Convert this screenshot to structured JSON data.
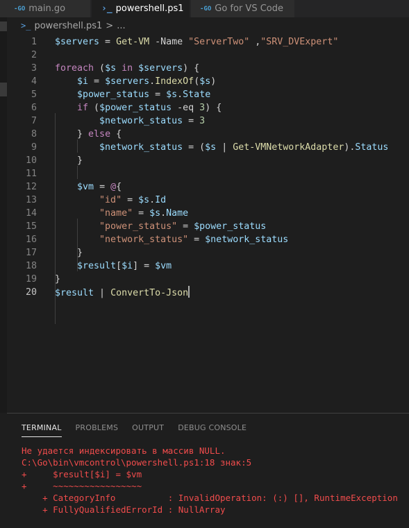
{
  "tabs": [
    {
      "label": "main.go",
      "icon": "go-file-icon",
      "active": false
    },
    {
      "label": "powershell.ps1",
      "icon": "powershell-file-icon",
      "active": true,
      "unsaved": true
    },
    {
      "label": "Go for VS Code",
      "icon": "go-extension-icon",
      "active": false
    }
  ],
  "icons": {
    "go": "-GO",
    "ps": ">_"
  },
  "breadcrumb": {
    "file": "powershell.ps1",
    "separator": ">",
    "rest": "..."
  },
  "editor": {
    "active_line": 20,
    "lines": [
      {
        "n": "1"
      },
      {
        "n": "2"
      },
      {
        "n": "3"
      },
      {
        "n": "4"
      },
      {
        "n": "5"
      },
      {
        "n": "6"
      },
      {
        "n": "7"
      },
      {
        "n": "8"
      },
      {
        "n": "9"
      },
      {
        "n": "10"
      },
      {
        "n": "11"
      },
      {
        "n": "12"
      },
      {
        "n": "13"
      },
      {
        "n": "14"
      },
      {
        "n": "15"
      },
      {
        "n": "16"
      },
      {
        "n": "17"
      },
      {
        "n": "18"
      },
      {
        "n": "19"
      },
      {
        "n": "20"
      }
    ],
    "code": [
      [
        [
          "v",
          "$servers"
        ],
        [
          "p",
          " = "
        ],
        [
          "f",
          "Get-VM"
        ],
        [
          "p",
          " -Name "
        ],
        [
          "s",
          "\"ServerTwo\""
        ],
        [
          "p",
          " ,"
        ],
        [
          "s",
          "\"SRV_DVExpert\""
        ]
      ],
      [],
      [
        [
          "k",
          "foreach"
        ],
        [
          "p",
          " ("
        ],
        [
          "v",
          "$s"
        ],
        [
          "k",
          " in "
        ],
        [
          "v",
          "$servers"
        ],
        [
          "p",
          ") {"
        ]
      ],
      [
        [
          "p",
          "    "
        ],
        [
          "v",
          "$i"
        ],
        [
          "p",
          " = "
        ],
        [
          "v",
          "$servers"
        ],
        [
          "p",
          "."
        ],
        [
          "f",
          "IndexOf"
        ],
        [
          "p",
          "("
        ],
        [
          "v",
          "$s"
        ],
        [
          "p",
          ")"
        ]
      ],
      [
        [
          "p",
          "    "
        ],
        [
          "v",
          "$power_status"
        ],
        [
          "p",
          " = "
        ],
        [
          "v",
          "$s"
        ],
        [
          "p",
          "."
        ],
        [
          "v",
          "State"
        ]
      ],
      [
        [
          "p",
          "    "
        ],
        [
          "k",
          "if"
        ],
        [
          "p",
          " ("
        ],
        [
          "v",
          "$power_status"
        ],
        [
          "p",
          " -eq "
        ],
        [
          "n",
          "3"
        ],
        [
          "p",
          ") {"
        ]
      ],
      [
        [
          "p",
          "        "
        ],
        [
          "v",
          "$network_status"
        ],
        [
          "p",
          " = "
        ],
        [
          "n",
          "3"
        ]
      ],
      [
        [
          "p",
          "    } "
        ],
        [
          "k",
          "else"
        ],
        [
          "p",
          " {"
        ]
      ],
      [
        [
          "p",
          "        "
        ],
        [
          "v",
          "$network_status"
        ],
        [
          "p",
          " = ("
        ],
        [
          "v",
          "$s"
        ],
        [
          "p",
          " | "
        ],
        [
          "f",
          "Get-VMNetworkAdapter"
        ],
        [
          "p",
          ")."
        ],
        [
          "v",
          "Status"
        ]
      ],
      [
        [
          "p",
          "    }"
        ]
      ],
      [],
      [
        [
          "p",
          "    "
        ],
        [
          "v",
          "$vm"
        ],
        [
          "p",
          " = "
        ],
        [
          "k",
          "@"
        ],
        [
          "p",
          "{"
        ]
      ],
      [
        [
          "p",
          "        "
        ],
        [
          "s",
          "\"id\""
        ],
        [
          "p",
          " = "
        ],
        [
          "v",
          "$s"
        ],
        [
          "p",
          "."
        ],
        [
          "v",
          "Id"
        ]
      ],
      [
        [
          "p",
          "        "
        ],
        [
          "s",
          "\"name\""
        ],
        [
          "p",
          " = "
        ],
        [
          "v",
          "$s"
        ],
        [
          "p",
          "."
        ],
        [
          "v",
          "Name"
        ]
      ],
      [
        [
          "p",
          "        "
        ],
        [
          "s",
          "\"power_status\""
        ],
        [
          "p",
          " = "
        ],
        [
          "v",
          "$power_status"
        ]
      ],
      [
        [
          "p",
          "        "
        ],
        [
          "s",
          "\"network_status\""
        ],
        [
          "p",
          " = "
        ],
        [
          "v",
          "$network_status"
        ]
      ],
      [
        [
          "p",
          "    }"
        ]
      ],
      [
        [
          "p",
          "    "
        ],
        [
          "v",
          "$result"
        ],
        [
          "p",
          "["
        ],
        [
          "v",
          "$i"
        ],
        [
          "p",
          "] = "
        ],
        [
          "v",
          "$vm"
        ]
      ],
      [
        [
          "p",
          "}"
        ]
      ],
      [
        [
          "v",
          "$result"
        ],
        [
          "p",
          " | "
        ],
        [
          "f",
          "ConvertTo-Json"
        ]
      ]
    ]
  },
  "panel": {
    "tabs": [
      "TERMINAL",
      "PROBLEMS",
      "OUTPUT",
      "DEBUG CONSOLE"
    ],
    "active_tab": "TERMINAL",
    "terminal_lines": [
      "Не удается индексировать в массив NULL.",
      "C:\\Go\\bin\\vmcontrol\\powershell.ps1:18 знак:5",
      "+     $result[$i] = $vm",
      "+     ~~~~~~~~~~~~~~~~~",
      "    + CategoryInfo          : InvalidOperation: (:) [], RuntimeException",
      "    + FullyQualifiedErrorId : NullArray"
    ]
  },
  "colors": {
    "background": "#1e1e1e",
    "tab_inactive": "#2d2d2d",
    "variable": "#9cdcfe",
    "keyword": "#c586c0",
    "function": "#dcdcaa",
    "string": "#ce9178",
    "number": "#b5cea8",
    "error": "#f14c4c"
  }
}
